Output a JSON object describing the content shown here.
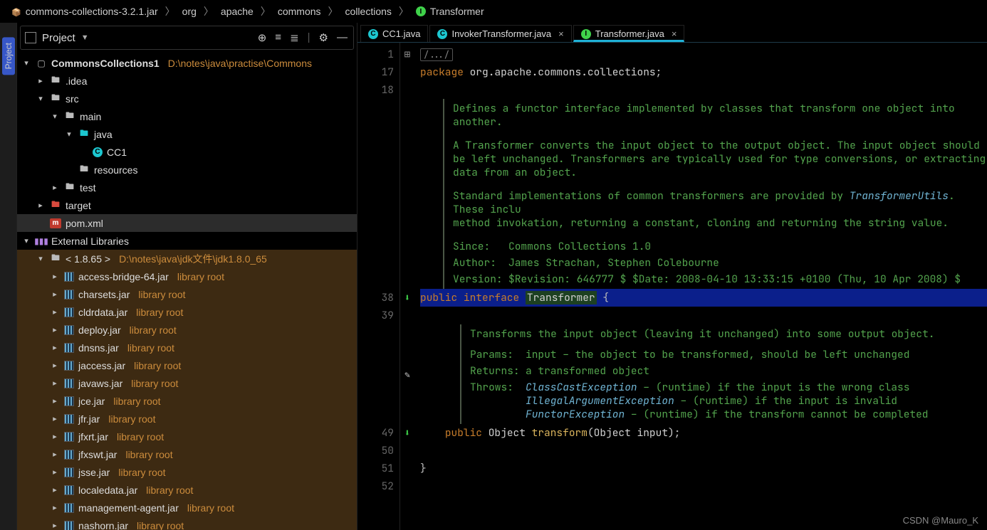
{
  "breadcrumb": {
    "items": [
      {
        "label": "commons-collections-3.2.1.jar",
        "icon": "jar"
      },
      {
        "label": "org"
      },
      {
        "label": "apache"
      },
      {
        "label": "commons"
      },
      {
        "label": "collections"
      },
      {
        "label": "Transformer",
        "icon": "iface"
      }
    ]
  },
  "project_header": {
    "title": "Project"
  },
  "tree": {
    "module": "CommonsCollections1",
    "module_path": "D:\\notes\\java\\practise\\Commons",
    "idea": ".idea",
    "src": "src",
    "main": "main",
    "java": "java",
    "cc1": "CC1",
    "resources": "resources",
    "test": "test",
    "target": "target",
    "pom": "pom.xml",
    "ext": "External Libraries",
    "jdk": "< 1.8.65 >",
    "jdk_path": "D:\\notes\\java\\jdk文件\\jdk1.8.0_65",
    "lib_suffix": "library root",
    "libs": [
      "access-bridge-64.jar",
      "charsets.jar",
      "cldrdata.jar",
      "deploy.jar",
      "dnsns.jar",
      "jaccess.jar",
      "javaws.jar",
      "jce.jar",
      "jfr.jar",
      "jfxrt.jar",
      "jfxswt.jar",
      "jsse.jar",
      "localedata.jar",
      "management-agent.jar",
      "nashorn.jar"
    ]
  },
  "tabs": [
    {
      "label": "CC1.java",
      "icon": "c",
      "active": false,
      "closable": false
    },
    {
      "label": "InvokerTransformer.java",
      "icon": "c",
      "active": false,
      "closable": true
    },
    {
      "label": "Transformer.java",
      "icon": "i",
      "active": true,
      "closable": true
    }
  ],
  "code": {
    "line_numbers": [
      "1",
      "17",
      "18",
      "",
      "",
      "",
      "",
      "",
      "",
      "",
      "",
      "",
      "38",
      "39",
      "",
      "",
      "",
      "",
      "",
      "",
      "",
      "49",
      "50",
      "51",
      "52"
    ],
    "ellipsis": "/.../",
    "kw_package": "package",
    "pkg": " org.apache.commons.collections",
    "semi": ";",
    "kw_public": "public",
    "kw_interface": " interface ",
    "type_name": "Transformer",
    "brace_open": " {",
    "kw_public2": "public ",
    "obj": "Object ",
    "method": "transform",
    "sig": "(Object input)",
    "semi2": ";",
    "brace_close": "}"
  },
  "doc": {
    "p1": "Defines a functor interface implemented by classes that transform one object into another.",
    "p2a": "A ",
    "p2code": "Transformer",
    "p2b": " converts the input object to the output object. The input object should be left unchanged. Transformers are typically used for type conversions, or extracting data from an object.",
    "p3a": "Standard implementations of common transformers are provided by ",
    "p3link": "TransformerUtils",
    "p3b": ". These inclu",
    "p3c": "method invokation, returning a constant, cloning and returning the string value.",
    "since_l": "Since:",
    "since_v": "Commons Collections 1.0",
    "author_l": "Author:",
    "author_v": "James Strachan, Stephen Colebourne",
    "version_l": "Version:",
    "version_v": "$Revision: 646777 $ $Date: 2008-04-10 13:33:15 +0100 (Thu, 10 Apr 2008) $",
    "m1": "Transforms the input object (leaving it unchanged) into some output object.",
    "params_l": "Params:",
    "params_v": "input – the object to be transformed, should be left unchanged",
    "returns_l": "Returns:",
    "returns_v": "a transformed object",
    "throws_l": "Throws:",
    "t1": "ClassCastException",
    "t1d": " – (runtime) if the input is the wrong class",
    "t2": "IllegalArgumentException",
    "t2d": " – (runtime) if the input is invalid",
    "t3": "FunctorException",
    "t3d": " – (runtime) if the transform cannot be completed"
  },
  "watermark": "CSDN @Mauro_K"
}
